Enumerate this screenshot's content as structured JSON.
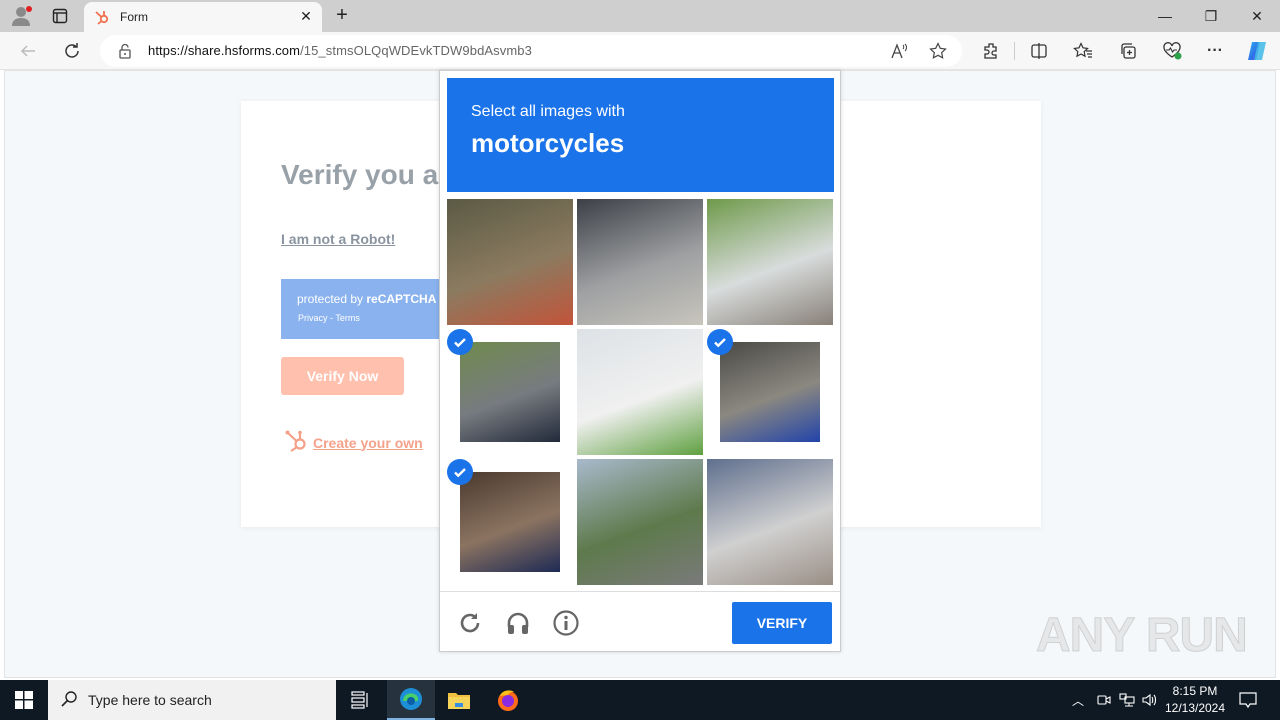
{
  "browser": {
    "tab_title": "Form",
    "url_domain": "https://share.hsforms.com",
    "url_path": "/15_stmsOLQqWDEvkTDW9bdAsvmb3",
    "window_controls": [
      "minimize",
      "restore",
      "close"
    ],
    "toolbar_icons": [
      "read-aloud-icon",
      "favorite-star-icon",
      "extensions-icon",
      "split-screen-icon",
      "favorites-icon",
      "collections-icon",
      "browser-essentials-icon",
      "more-icon",
      "copilot-icon"
    ]
  },
  "form": {
    "heading": "Verify you a",
    "robot_link": "I am not a Robot!",
    "recaptcha_protected": "protected by ",
    "recaptcha_brand": "reCAPTCHA",
    "recaptcha_links": "Privacy - Terms",
    "verify_now": "Verify Now",
    "create_link": "Create your own fr"
  },
  "captcha": {
    "instruction": "Select all images with",
    "target": "motorcycles",
    "tiles": [
      {
        "desc": "scooter parked near tree",
        "selected": false,
        "colors": [
          "#5b5a44",
          "#8b7b60",
          "#c2543a"
        ]
      },
      {
        "desc": "metal barrier fence",
        "selected": false,
        "colors": [
          "#3c3f46",
          "#9ea0a2",
          "#c8c5bd"
        ]
      },
      {
        "desc": "tree with truck behind",
        "selected": false,
        "colors": [
          "#6e9a4a",
          "#d8dcdc",
          "#888078"
        ]
      },
      {
        "desc": "rider on motorcycle",
        "selected": true,
        "colors": [
          "#6f8a4d",
          "#777b80",
          "#222a3a"
        ]
      },
      {
        "desc": "white house",
        "selected": false,
        "colors": [
          "#dde2e6",
          "#f0f0f0",
          "#5fa040"
        ]
      },
      {
        "desc": "parked motorbikes",
        "selected": true,
        "colors": [
          "#4a4a45",
          "#8b8880",
          "#2244aa"
        ]
      },
      {
        "desc": "motorcycle close-up",
        "selected": true,
        "colors": [
          "#4a3a30",
          "#8b7360",
          "#1e2a55"
        ]
      },
      {
        "desc": "highway road",
        "selected": false,
        "colors": [
          "#a9b9cc",
          "#5e7a4c",
          "#7a7a7a"
        ]
      },
      {
        "desc": "blue siding house with car",
        "selected": false,
        "colors": [
          "#5f6f8e",
          "#d0d0d0",
          "#9a8f86"
        ]
      }
    ],
    "footer_icons": [
      "reload-icon",
      "audio-icon",
      "info-icon"
    ],
    "verify_label": "VERIFY",
    "accent": "#1a73e8"
  },
  "watermark": "ANY RUN",
  "taskbar": {
    "search_placeholder": "Type here to search",
    "time": "8:15 PM",
    "date": "12/13/2024"
  }
}
